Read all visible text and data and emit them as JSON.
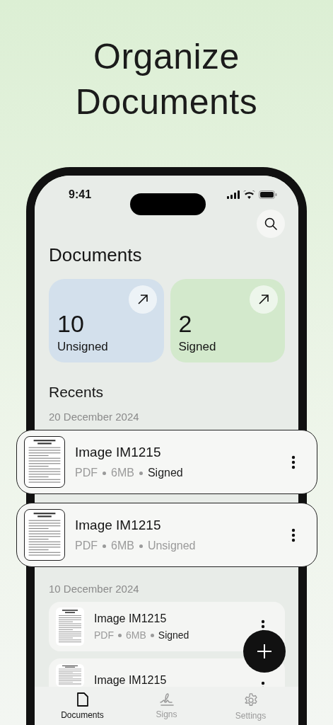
{
  "headline": [
    "Organize",
    "Documents"
  ],
  "status_bar": {
    "time": "9:41"
  },
  "title": "Documents",
  "summary_cards": [
    {
      "count": "10",
      "label": "Unsigned",
      "color": "#d3e0ec"
    },
    {
      "count": "2",
      "label": "Signed",
      "color": "#d3e9cc"
    }
  ],
  "recents_title": "Recents",
  "groups": [
    {
      "date": "20 December 2024",
      "items": [
        {
          "name": "Image IM1215",
          "type": "PDF",
          "size": "6MB",
          "status": "Signed",
          "signed": true,
          "elevated": true
        },
        {
          "name": "Image IM1215",
          "type": "PDF",
          "size": "6MB",
          "status": "Unsigned",
          "signed": false,
          "elevated": true
        }
      ]
    },
    {
      "date": "10 December 2024",
      "items": [
        {
          "name": "Image IM1215",
          "type": "PDF",
          "size": "6MB",
          "status": "Signed",
          "signed": true,
          "elevated": false
        },
        {
          "name": "Image IM1215",
          "elevated": false
        }
      ]
    }
  ],
  "tabs": [
    {
      "label": "Documents",
      "kind": "document",
      "selected": true
    },
    {
      "label": "Signs",
      "kind": "signature",
      "selected": false
    },
    {
      "label": "Settings",
      "kind": "settings",
      "selected": false
    }
  ]
}
